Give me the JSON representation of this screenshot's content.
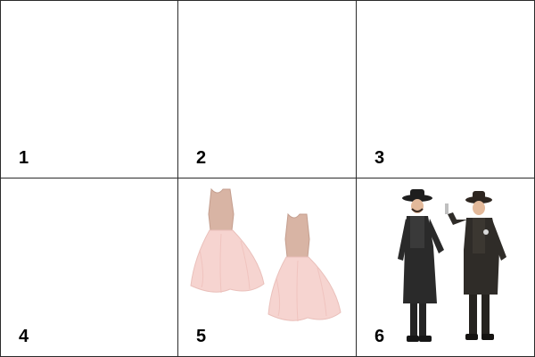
{
  "grid": {
    "cells": [
      {
        "label": "1",
        "content": "empty"
      },
      {
        "label": "2",
        "content": "empty"
      },
      {
        "label": "3",
        "content": "empty"
      },
      {
        "label": "4",
        "content": "empty"
      },
      {
        "label": "5",
        "content": "tutu-dresses-image"
      },
      {
        "label": "6",
        "content": "cowboy-costumes-image"
      }
    ]
  },
  "colors": {
    "border": "#2b2b2b",
    "dress_bodice": "#d8b4a4",
    "dress_tulle": "#f6d4d0",
    "costume_dark": "#2a2a2a"
  }
}
